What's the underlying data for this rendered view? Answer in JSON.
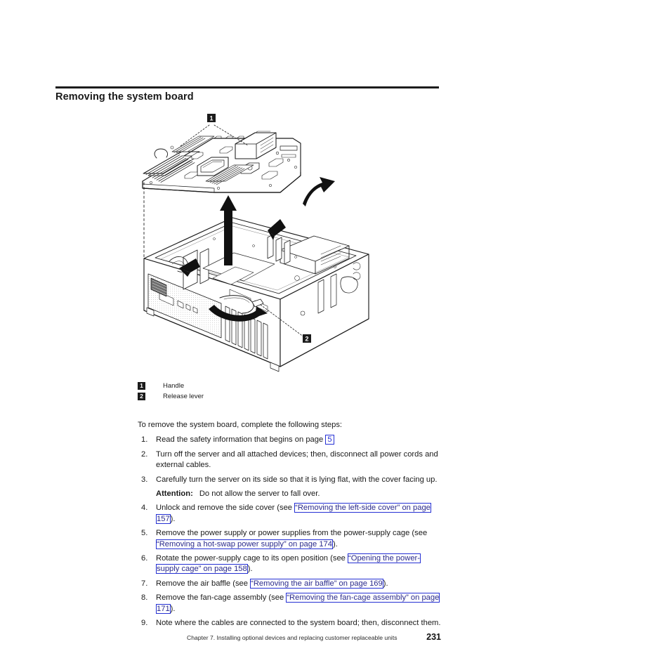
{
  "heading": {
    "title": "Removing the system board"
  },
  "figure": {
    "callout_1": "1",
    "callout_2": "2",
    "alt": "Exploded isometric line drawing of a server chassis lying on its side with the system board lifted out"
  },
  "legend": {
    "items": [
      {
        "badge": "1",
        "label": "Handle"
      },
      {
        "badge": "2",
        "label": "Release lever"
      }
    ]
  },
  "body": {
    "intro": "To remove the system board, complete the following steps:",
    "steps": [
      {
        "num": "1.",
        "parts": [
          {
            "type": "text",
            "text": "Read the safety information that begins on page "
          },
          {
            "type": "xref-page",
            "text": "5"
          }
        ]
      },
      {
        "num": "2.",
        "parts": [
          {
            "type": "text",
            "text": "Turn off the server and all attached devices; then, disconnect all power cords and external cables."
          }
        ]
      },
      {
        "num": "3.",
        "parts": [
          {
            "type": "text",
            "text": "Carefully turn the server on its side so that it is lying flat, with the cover facing up."
          }
        ]
      },
      {
        "num": "4.",
        "parts": [
          {
            "type": "text",
            "text": "Unlock and remove the side cover (see "
          },
          {
            "type": "xref",
            "text": "“Removing the left-side cover” on page 157"
          },
          {
            "type": "text",
            "text": ")."
          }
        ]
      },
      {
        "num": "5.",
        "parts": [
          {
            "type": "text",
            "text": "Remove the power supply or power supplies from the power-supply cage (see "
          },
          {
            "type": "xref",
            "text": "“Removing a hot-swap power supply” on page 174"
          },
          {
            "type": "text",
            "text": ")."
          }
        ]
      },
      {
        "num": "6.",
        "parts": [
          {
            "type": "text",
            "text": "Rotate the power-supply cage to its open position (see "
          },
          {
            "type": "xref",
            "text": "“Opening the power-supply cage” on page 158"
          },
          {
            "type": "text",
            "text": ")."
          }
        ]
      },
      {
        "num": "7.",
        "parts": [
          {
            "type": "text",
            "text": "Remove the air baffle (see "
          },
          {
            "type": "xref",
            "text": "“Removing the air baffle” on page 169"
          },
          {
            "type": "text",
            "text": ")."
          }
        ]
      },
      {
        "num": "8.",
        "parts": [
          {
            "type": "text",
            "text": "Remove the fan-cage assembly (see "
          },
          {
            "type": "xref",
            "text": "“Removing the fan-cage assembly” on page 171"
          },
          {
            "type": "text",
            "text": ")."
          }
        ]
      },
      {
        "num": "9.",
        "parts": [
          {
            "type": "text",
            "text": "Note where the cables are connected to the system board; then, disconnect them."
          }
        ]
      }
    ],
    "attention": {
      "label": "Attention:",
      "text": "Do not allow the server to fall over."
    }
  },
  "footer": {
    "chapter_text": "Chapter 7. Installing optional devices and replacing customer replaceable units",
    "page_number": "231"
  },
  "colors": {
    "link": "#2530d4",
    "link_text": "#2a2a8c",
    "rule": "#1c1c1c",
    "badge_bg": "#1b1b1b",
    "ink": "#1a1a1a"
  }
}
